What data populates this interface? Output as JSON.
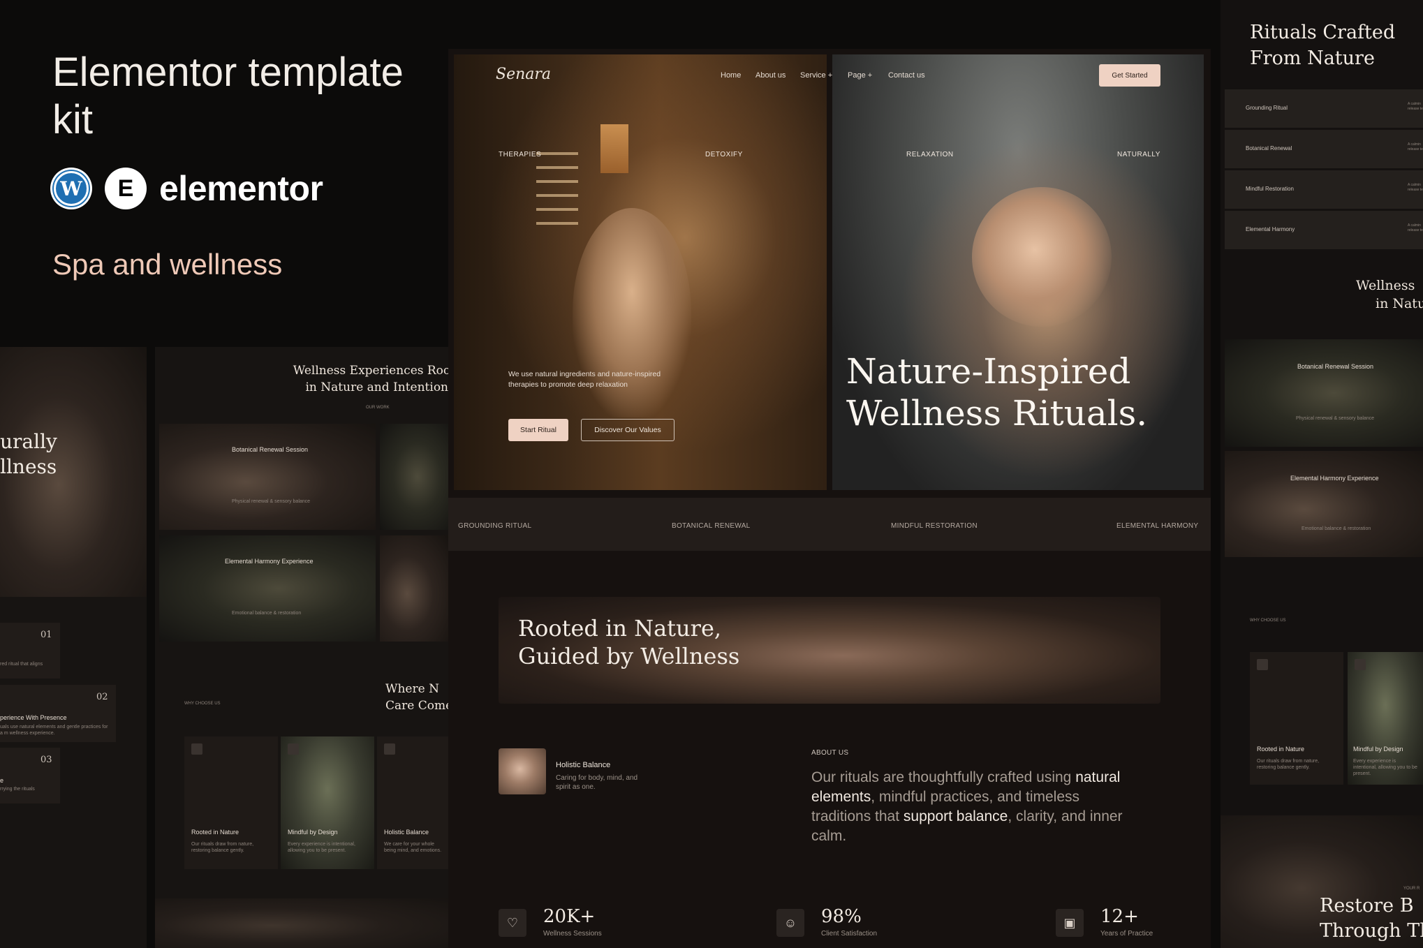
{
  "promo": {
    "title": "Elementor template kit",
    "elementor_word": "elementor",
    "subtitle": "Spa and wellness",
    "wp_icon": "wordpress-icon",
    "el_icon": "elementor-icon",
    "wp_glyph": "W",
    "el_glyph": "E"
  },
  "nav": {
    "brand": "Senara",
    "links": [
      "Home",
      "About us",
      "Service +",
      "Page +",
      "Contact us"
    ],
    "cta": "Get Started"
  },
  "hero": {
    "words": [
      "THERAPIES",
      "DETOXIFY",
      "RELAXATION",
      "NATURALLY"
    ],
    "description": "We use natural ingredients and nature-inspired therapies to promote deep relaxation",
    "primary_button": "Start Ritual",
    "secondary_button": "Discover Our Values",
    "headline_line1": "Nature-Inspired",
    "headline_line2": "Wellness Rituals."
  },
  "services_strip": [
    "GROUNDING RITUAL",
    "BOTANICAL RENEWAL",
    "MINDFUL RESTORATION",
    "ELEMENTAL HARMONY"
  ],
  "banner": {
    "line1": "Rooted in Nature,",
    "line2": "Guided by Wellness"
  },
  "about": {
    "card_title": "Holistic Balance",
    "card_desc": "Caring for body, mind, and spirit as one.",
    "label": "ABOUT US",
    "text_a": "Our rituals are thoughtfully crafted using ",
    "text_b": "natural elements",
    "text_c": ", mindful practices, and timeless traditions that ",
    "text_d": "support balance",
    "text_e": ", clarity, and inner calm."
  },
  "stats": [
    {
      "icon": "heart-icon",
      "glyph": "♡",
      "value": "20K+",
      "label": "Wellness Sessions"
    },
    {
      "icon": "smile-icon",
      "glyph": "☺",
      "value": "98%",
      "label": "Client Satisfaction"
    },
    {
      "icon": "calendar-icon",
      "glyph": "▣",
      "value": "12+",
      "label": "Years of Practice"
    }
  ],
  "left_preview": {
    "heading_line1": "urally",
    "heading_line2": "llness",
    "numbers": [
      "01",
      "02",
      "03"
    ],
    "item2_title": "perience With Presence",
    "item1_text": "red ritual that aligns",
    "item2_text": "uals use natural elements and gentle practices for a m wellness experience.",
    "item3_title": "e",
    "item3_text": "rrying the rituals"
  },
  "mid_preview": {
    "heading_line1": "Wellness Experiences Root",
    "heading_line2": "in Nature and Intention",
    "label": "OUR WORK",
    "card1_title": "Botanical Renewal Session",
    "card1_sub": "Physical renewal & sensory balance",
    "card2_title": "Elemental Harmony Experience",
    "card2_sub": "Emotional balance & restoration",
    "why_label": "WHY CHOOSE US",
    "why_heading_line1": "Where N",
    "why_heading_line2": "Care Come",
    "features": [
      {
        "title": "Rooted in Nature",
        "desc": "Our rituals draw from nature, restoring balance gently."
      },
      {
        "title": "Mindful by Design",
        "desc": "Every experience is intentional, allowing you to be present."
      },
      {
        "title": "Holistic Balance",
        "desc": "We care for your whole being mind, and emotions."
      }
    ]
  },
  "right_preview": {
    "heading_line1": "Rituals Crafted",
    "heading_line2": "From Nature",
    "rows": [
      "Grounding Ritual",
      "Botanical Renewal",
      "Mindful Restoration",
      "Elemental Harmony"
    ],
    "row_snippet": "A calmin release te",
    "heading2_line1": "Wellness",
    "heading2_line2": "in Natur",
    "card1_title": "Botanical Renewal Session",
    "card1_sub": "Physical renewal & sensory balance",
    "card2_title": "Elemental Harmony Experience",
    "card2_sub": "Emotional balance & restoration",
    "why_label": "WHY CHOOSE US",
    "feature1_title": "Rooted in Nature",
    "feature1_desc": "Our rituals draw from nature, restoring balance gently.",
    "feature2_title": "Mindful by Design",
    "feature2_desc": "Every experience is intentional, allowing you to be present.",
    "your_label": "YOUR R",
    "heading3_line1": "Restore B",
    "heading3_line2": "Through The"
  }
}
